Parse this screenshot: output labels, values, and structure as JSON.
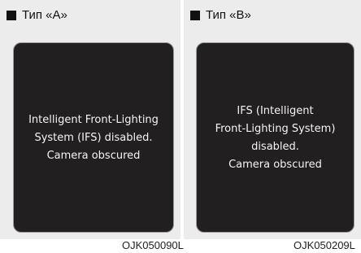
{
  "panels": [
    {
      "header": "Тип «A»",
      "message": "Intelligent Front-Lighting\nSystem (IFS) disabled.\nCamera obscured",
      "code": "OJK050090L"
    },
    {
      "header": "Тип «B»",
      "message": "IFS (Intelligent\nFront-Lighting System)\ndisabled.\nCamera obscured",
      "code": "OJK050209L"
    }
  ],
  "colors": {
    "panel_background": "#ececec",
    "screen_background": "#221f21",
    "screen_text": "#f4f4f4",
    "bullet": "#111111"
  }
}
